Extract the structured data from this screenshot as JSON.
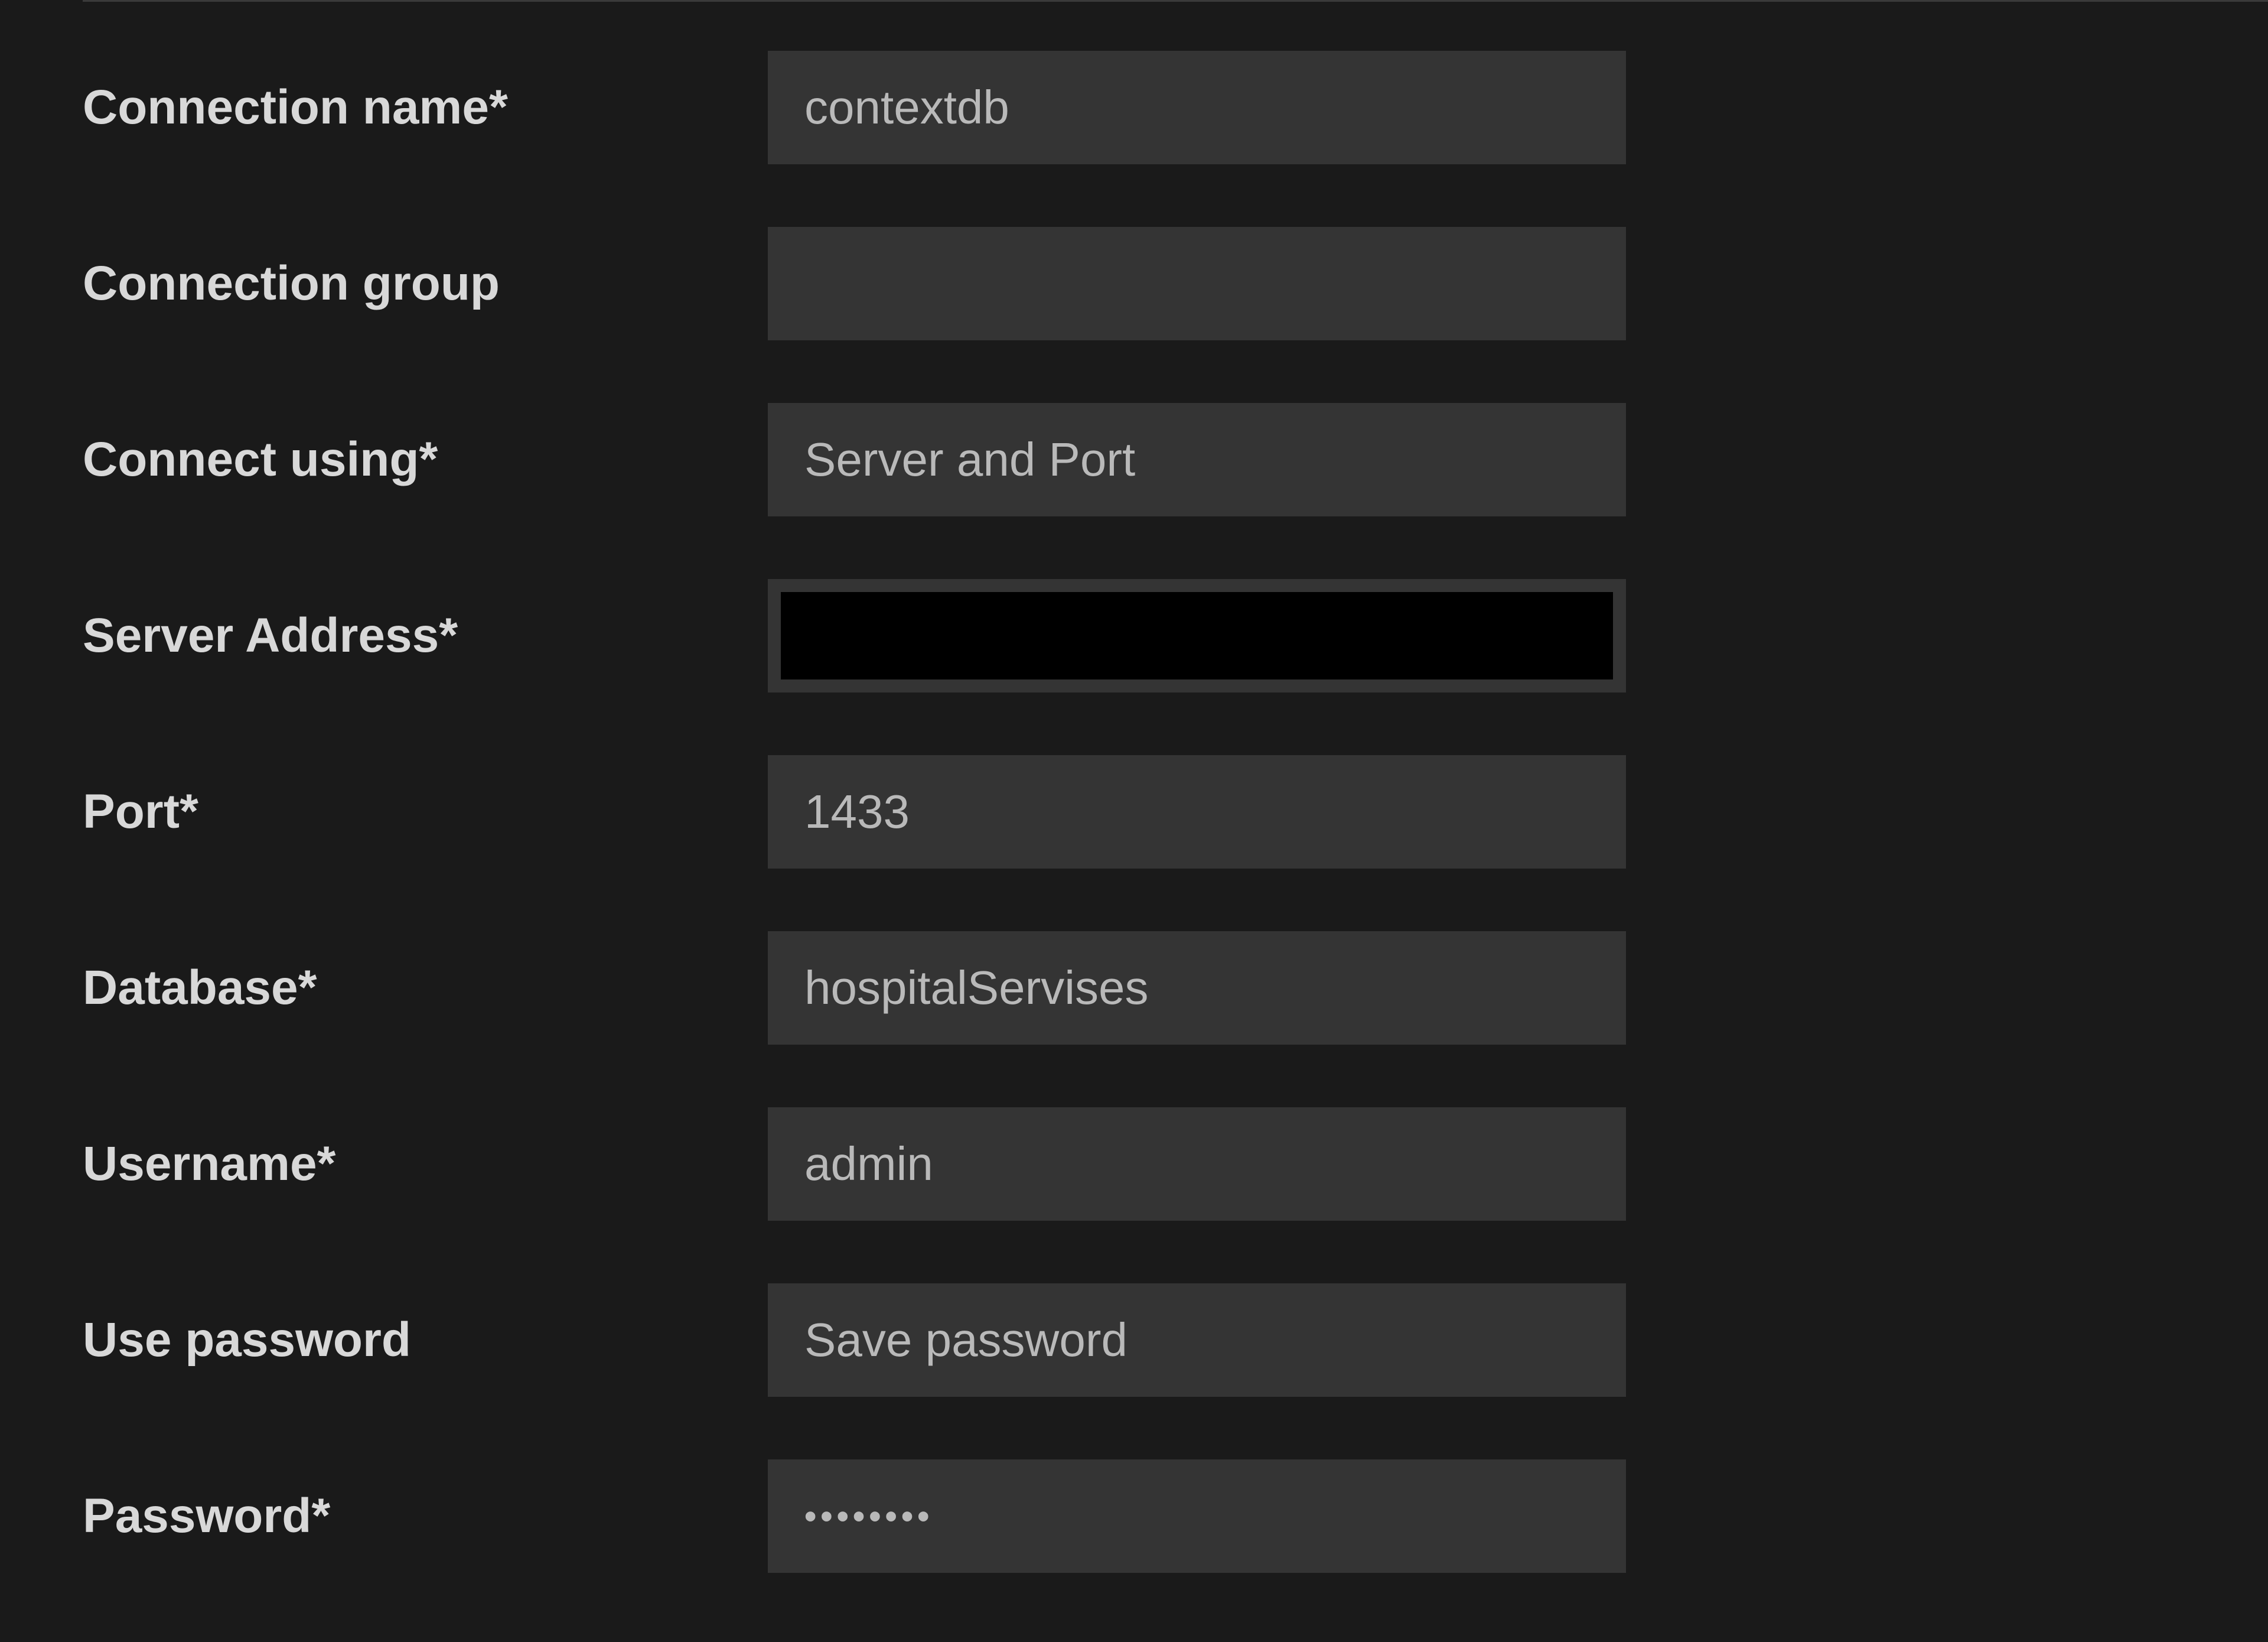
{
  "form": {
    "connection_name": {
      "label": "Connection name*",
      "value": "contextdb"
    },
    "connection_group": {
      "label": "Connection group",
      "value": ""
    },
    "connect_using": {
      "label": "Connect using*",
      "value": "Server and Port"
    },
    "server_address": {
      "label": "Server Address*",
      "value": ""
    },
    "port": {
      "label": "Port*",
      "value": "1433"
    },
    "database": {
      "label": "Database*",
      "value": "hospitalServises"
    },
    "username": {
      "label": "Username*",
      "value": "admin"
    },
    "use_password": {
      "label": "Use password",
      "value": "Save password"
    },
    "password": {
      "label": "Password*",
      "value": "••••••••"
    }
  }
}
